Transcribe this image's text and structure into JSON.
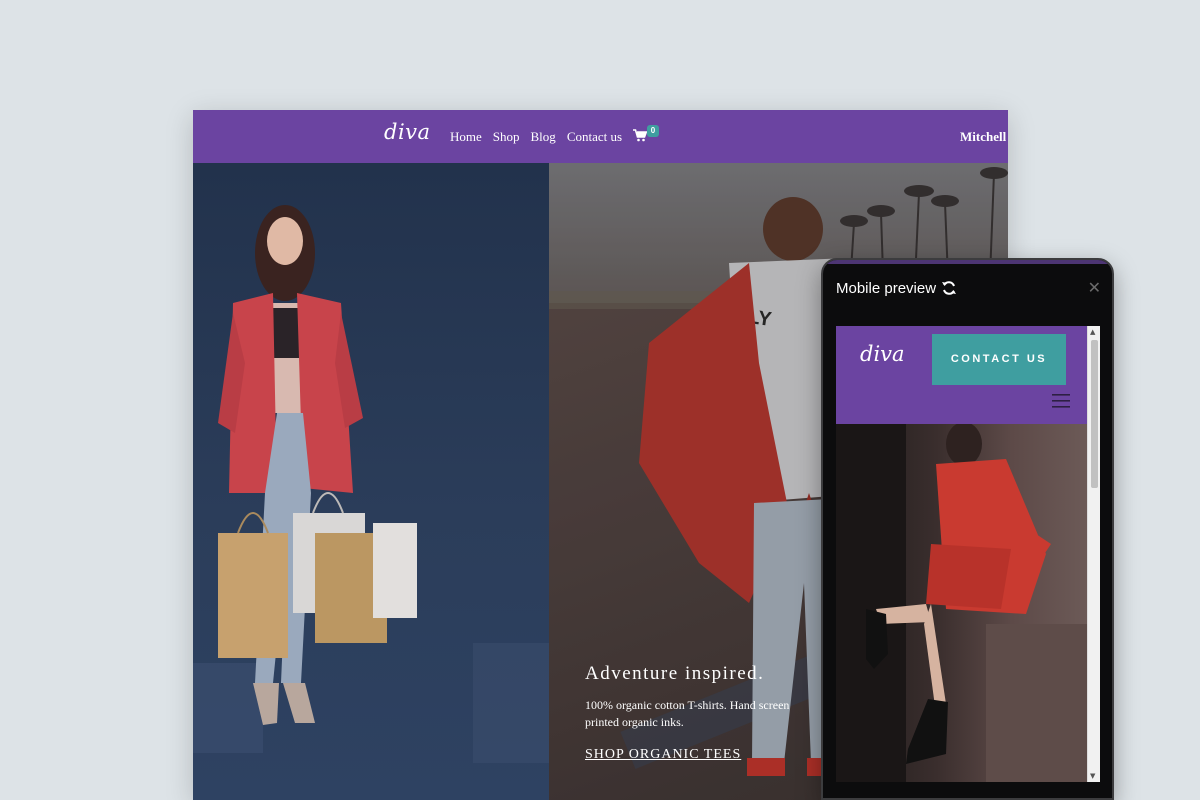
{
  "desktop": {
    "logo": "diva",
    "nav": [
      "Home",
      "Shop",
      "Blog",
      "Contact us"
    ],
    "cart_count": "0",
    "account_name": "Mitchell A",
    "hero": {
      "title": "Adventure inspired.",
      "subtitle": "100% organic cotton T-shirts. Hand screen printed organic inks.",
      "cta": "SHOP ORGANIC TEES"
    }
  },
  "mobile_preview": {
    "title": "Mobile preview",
    "logo": "diva",
    "contact_button": "CONTACT US"
  },
  "colors": {
    "background": "#dde3e7",
    "nav_purple": "#6b44a1",
    "accent_teal": "#3f9ea0"
  }
}
